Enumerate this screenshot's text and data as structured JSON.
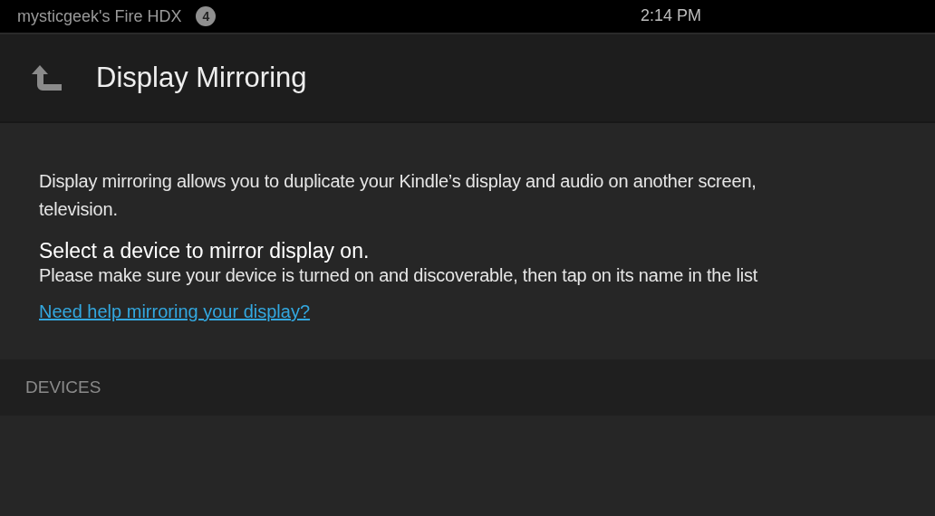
{
  "status_bar": {
    "device_name": "mysticgeek's Fire HDX",
    "notification_count": "4",
    "time": "2:14 PM"
  },
  "header": {
    "title": "Display Mirroring"
  },
  "description_lines": [
    "Display mirroring allows you to duplicate your Kindle’s display and audio on another screen,",
    "television."
  ],
  "prompt": {
    "heading": "Select a device to mirror display on.",
    "text": "Please make sure your device is turned on and discoverable, then tap on its name in the list"
  },
  "help_link": "Need help mirroring your display?",
  "devices_section": {
    "label": "DEVICES"
  }
}
